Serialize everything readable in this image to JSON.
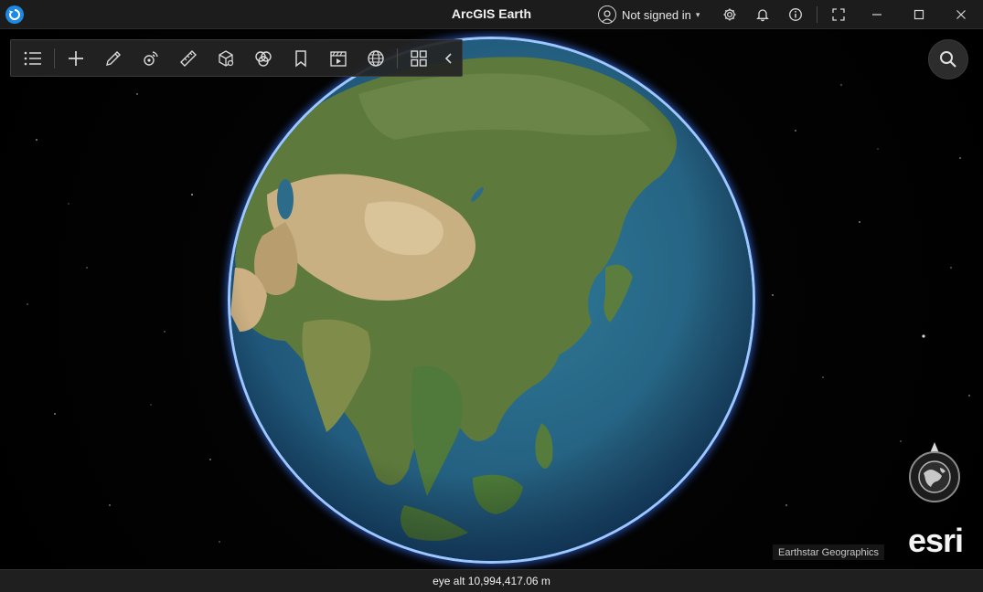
{
  "window": {
    "title": "ArcGIS Earth",
    "account": {
      "label": "Not signed in",
      "caret": "▾"
    },
    "buttons": [
      "settings",
      "notifications",
      "about",
      "fullscreen",
      "minimize",
      "maximize",
      "close"
    ]
  },
  "toolbar": {
    "tools": [
      {
        "name": "contents",
        "icon": "list-icon"
      },
      {
        "name": "add-data",
        "icon": "plus-icon"
      },
      {
        "name": "draw",
        "icon": "pencil-icon"
      },
      {
        "name": "interactive-analysis",
        "icon": "satellite-icon"
      },
      {
        "name": "measure",
        "icon": "ruler-icon"
      },
      {
        "name": "3d-analysis",
        "icon": "cube-icon"
      },
      {
        "name": "overlay",
        "icon": "overlap-circles-icon"
      },
      {
        "name": "bookmarks",
        "icon": "bookmark-icon"
      },
      {
        "name": "tour",
        "icon": "film-icon"
      },
      {
        "name": "web-maps",
        "icon": "globe-grid-icon"
      },
      {
        "name": "app-menu",
        "icon": "grid-icon"
      },
      {
        "name": "collapse",
        "icon": "chevron-left-icon"
      }
    ]
  },
  "map": {
    "attribution": "Earthstar Geographics",
    "logo": "esri",
    "search_icon": "search-icon",
    "navigator_icon": "globe-compass-icon"
  },
  "status": {
    "eye_alt": "eye alt 10,994,417.06 m"
  },
  "colors": {
    "titlebar": "#1c1c1c",
    "toolbar": "#242424",
    "halo": "#9cc7ff",
    "ocean": "#2a6e8f",
    "land_green": "#5f7a3a",
    "land_desert": "#c9b384"
  }
}
